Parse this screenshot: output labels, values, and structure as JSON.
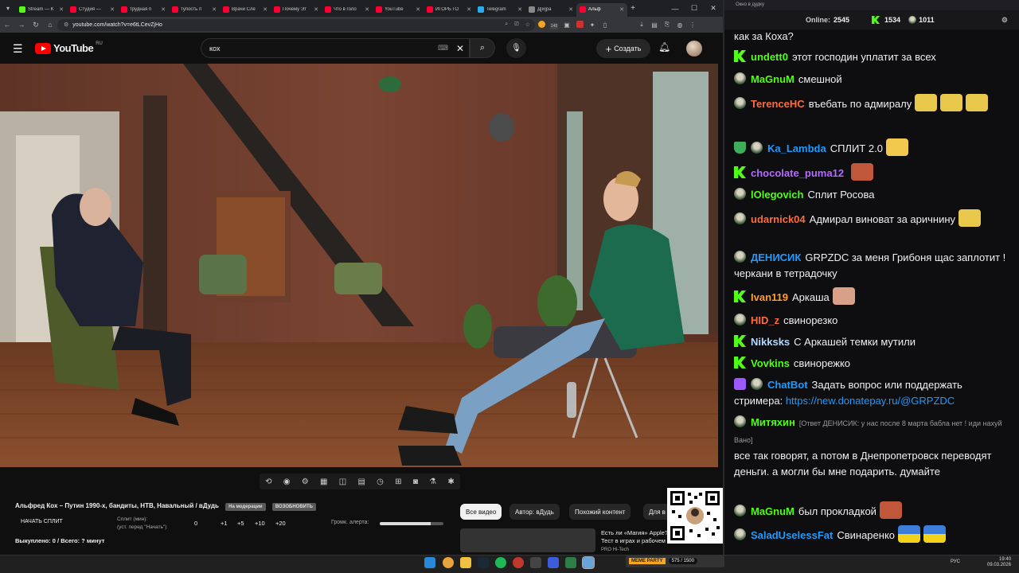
{
  "browser": {
    "tabs": [
      {
        "label": "Stream — K",
        "color": "#53fc18"
      },
      {
        "label": "Студия —",
        "color": "#ff0033"
      },
      {
        "label": "трудная п",
        "color": "#ff0033"
      },
      {
        "label": "тупость п",
        "color": "#ff0033"
      },
      {
        "label": "Врачи Сле",
        "color": "#ff0033"
      },
      {
        "label": "Почему Эт",
        "color": "#ff0033"
      },
      {
        "label": "Что в голо",
        "color": "#ff0033"
      },
      {
        "label": "YouTube",
        "color": "#ff0033"
      },
      {
        "label": "ИГОРЬ ГО",
        "color": "#ff0033"
      },
      {
        "label": "Telegram",
        "color": "#2aabee"
      },
      {
        "label": "Д[и]ра",
        "color": "#888888"
      },
      {
        "label": "Альф",
        "color": "#ff0033"
      }
    ],
    "url": "youtube.com/watch?v=e6tLCevZjHo",
    "ext_count": "148"
  },
  "youtube": {
    "logo_text": "YouTube",
    "region": "RU",
    "search_value": "кох",
    "create_label": "Создать"
  },
  "player": {
    "title": "Альфред Кох – Путин 1990-х, бандиты, НТВ, Навальный / вДудь",
    "badge1": "На модерации",
    "badge2": "ВОЗОБНОВИТЬ",
    "split_button": "НАЧАТЬ СПЛИТ",
    "split_label": "Сплит (мин):",
    "split_hint": "(уст. перед \"Начать\")",
    "split_values": [
      "0",
      "+1",
      "+5",
      "+10",
      "+20"
    ],
    "alert_label": "Громк. алерта:",
    "alert_volume": 0.8,
    "bought": "Выкуплено: 0 / Всего: ? минут"
  },
  "chips": [
    "Все видео",
    "Автор: вДудь",
    "Похожий контент",
    "Для в"
  ],
  "recommendation": {
    "title_line1": "Есть ли «Магия» Apple?",
    "title_line2": "Тест в играх и рабочем ПО…",
    "channel": "PRO Hi-Tech"
  },
  "chat": {
    "window_title": "Окно в дудку",
    "online_label": "Online:",
    "online": "2545",
    "kick_count": "1534",
    "other_count": "1011",
    "messages": [
      {
        "icon": "",
        "name": "",
        "color": "#efeff1",
        "text": "как за Коха?"
      },
      {
        "icon": "kick",
        "name": "undett0",
        "color": "#53fc18",
        "text": "этот господин уплатит за всех"
      },
      {
        "icon": "avatar",
        "name": "MaGnuM",
        "color": "#53fc18",
        "text": "смешной"
      },
      {
        "icon": "avatar",
        "name": "TerenceHC",
        "color": "#ff6a3d",
        "text": "въебать по адмиралу"
      },
      {
        "icon": "avatar",
        "name": "Ka_Lambda",
        "color": "#1e9bff",
        "text": "СПЛИТ 2.0"
      },
      {
        "icon": "kick",
        "name": "chocolate_puma12",
        "color": "#b46bff",
        "text": ""
      },
      {
        "icon": "avatar",
        "name": "lOlegovich",
        "color": "#53fc18",
        "text": "Сплит Росова"
      },
      {
        "icon": "avatar",
        "name": "udarnick04",
        "color": "#ff6a3d",
        "text": "Адмирал виноват за аричнину"
      },
      {
        "icon": "avatar",
        "name": "ДЕНИСИК",
        "color": "#1e9bff",
        "text": "GRPZDC за меня Грибоня щас заплотит ! черкани в тетрадочку"
      },
      {
        "icon": "kick",
        "name": "Ivan119",
        "color": "#ff9d2e",
        "text": "Аркаша"
      },
      {
        "icon": "avatar",
        "name": "HID_z",
        "color": "#ff6a3d",
        "text": "свинорезко"
      },
      {
        "icon": "kick",
        "name": "Nikksks",
        "color": "#b3d9ff",
        "text": "С Аркашей темки мутили"
      },
      {
        "icon": "kick",
        "name": "Vovkins",
        "color": "#53fc18",
        "text": "свинорежко"
      },
      {
        "icon": "bot",
        "name": "ChatBot",
        "color": "#1e9bff",
        "text": "Задать вопрос или поддержать стримера:",
        "link": "https://new.donatepay.ru/@GRPZDC"
      },
      {
        "icon": "avatar",
        "name": "Митяхин",
        "color": "#53fc18",
        "reply": "[Ответ ДЕНИСИК: у нас после 8 марта бабла нет ! иди нахуй Вано]",
        "text": "все так говорят, а потом в Днепропетровск переводят деньги. а могли бы мне подарить. думайте"
      },
      {
        "icon": "avatar",
        "name": "MaGnuM",
        "color": "#53fc18",
        "text": "был прокладкой"
      },
      {
        "icon": "avatar",
        "name": "SaladUselessFat",
        "color": "#1e9bff",
        "text": "Свинаренко"
      }
    ]
  },
  "taskbar": {
    "meme_text": "MEME PARTY",
    "meme_count": "575 / 1500",
    "lang": "РУС",
    "time": "19:40",
    "date": "09.03.2026"
  }
}
